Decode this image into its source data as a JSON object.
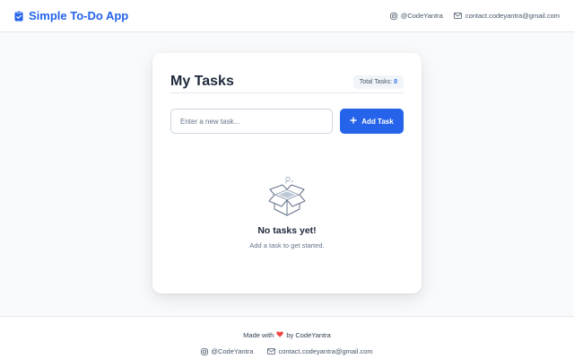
{
  "header": {
    "title": "Simple To-Do App",
    "social_handle": "@CodeYantra",
    "email": "contact.codeyantra@gmail.com"
  },
  "card": {
    "title": "My Tasks",
    "total_label": "Total Tasks:",
    "total_count": "0",
    "input_placeholder": "Enter a new task...",
    "input_value": "",
    "add_button_label": "Add Task",
    "empty_title": "No tasks yet!",
    "empty_subtitle": "Add a task to get started."
  },
  "footer": {
    "made_with_prefix": "Made with",
    "made_with_suffix": "by CodeYantra",
    "social_handle": "@CodeYantra",
    "email": "contact.codeyantra@gmail.com"
  },
  "icons": {
    "brand": "clipboard-check-icon",
    "instagram": "instagram-icon",
    "email": "envelope-icon",
    "add": "plus-icon",
    "empty": "open-box-icon",
    "heart": "heart-icon"
  },
  "colors": {
    "accent": "#2563eb",
    "background": "#f8fafc",
    "heart": "#ef4444",
    "text_dark": "#1e293b",
    "text_muted": "#64748b"
  }
}
